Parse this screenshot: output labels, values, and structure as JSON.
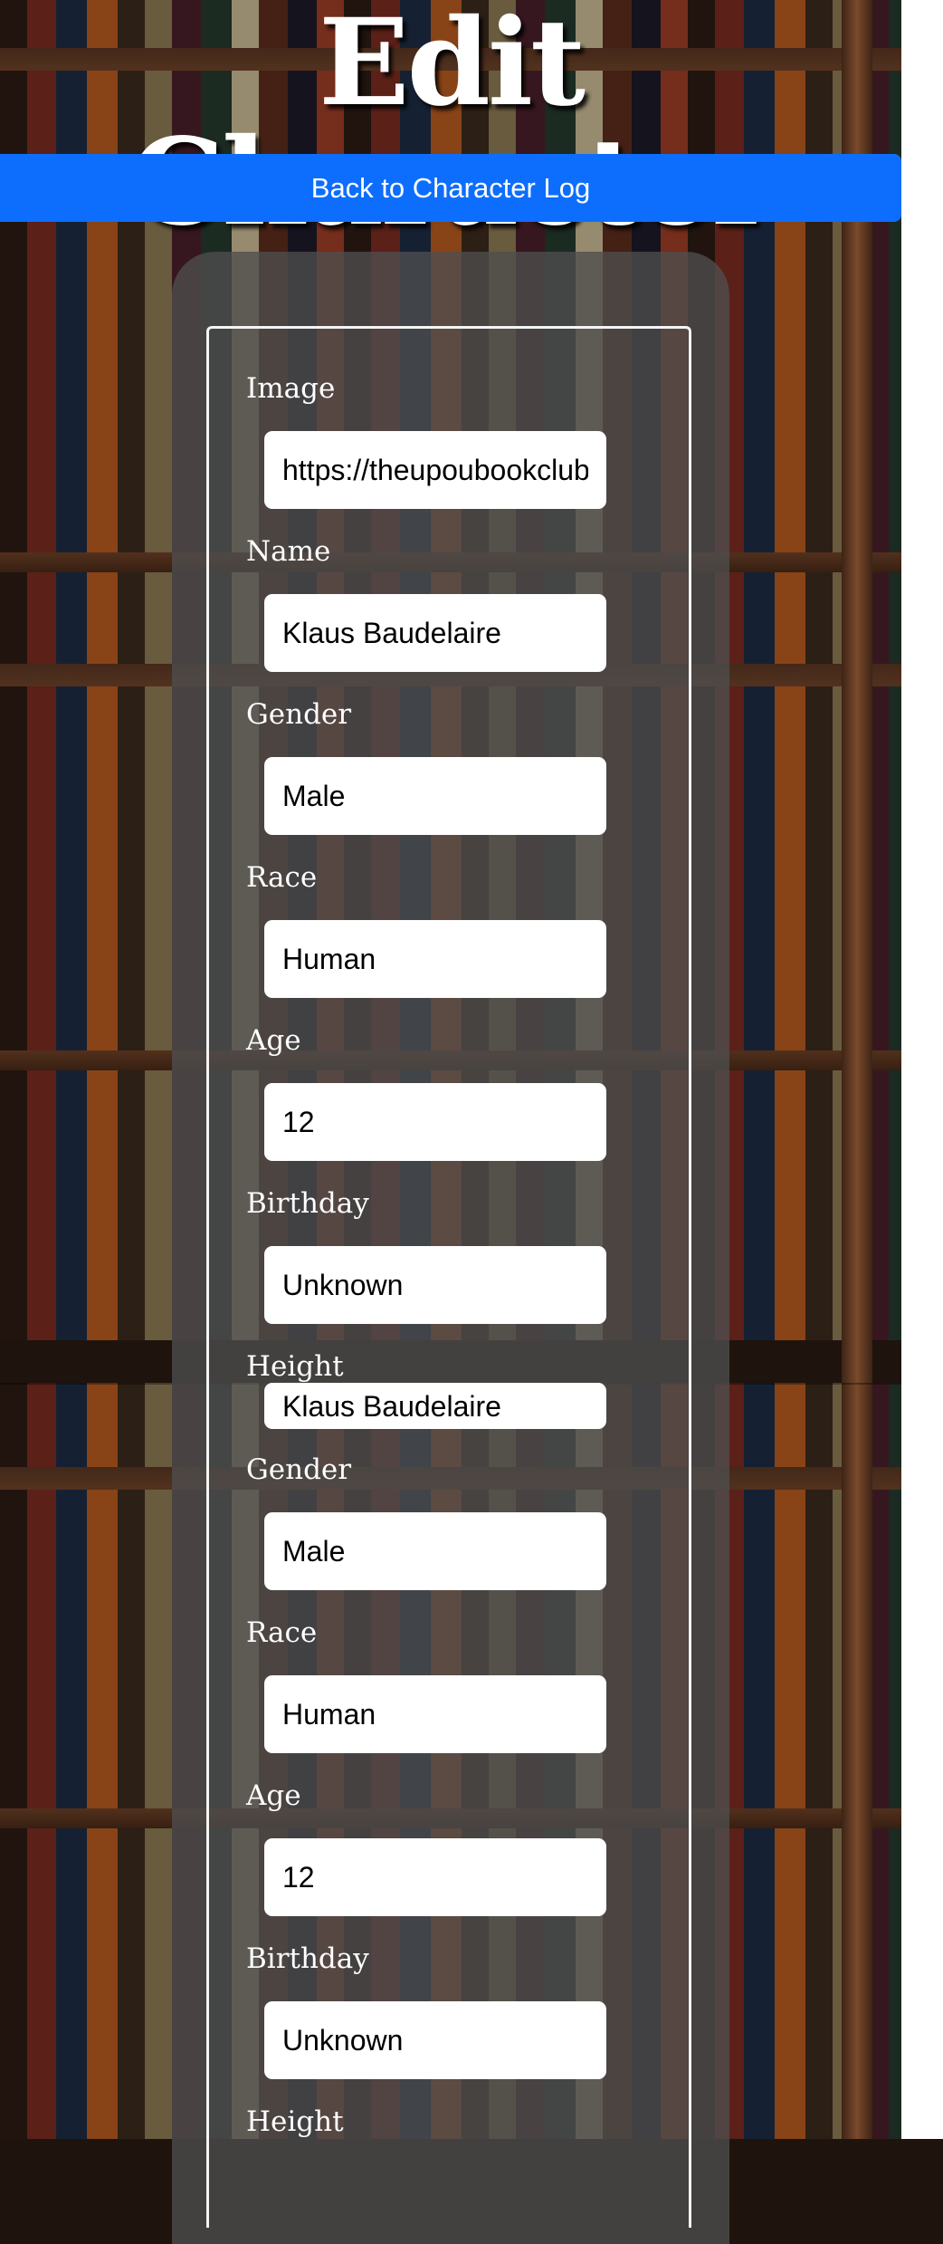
{
  "page": {
    "title": "Edit Character"
  },
  "header": {
    "back_button": "Back to Character Log"
  },
  "form": {
    "fields": [
      {
        "label": "Image",
        "value": "https://theupoubookclub"
      },
      {
        "label": "Name",
        "value": "Klaus Baudelaire"
      },
      {
        "label": "Gender",
        "value": "Male"
      },
      {
        "label": "Race",
        "value": "Human"
      },
      {
        "label": "Age",
        "value": "12"
      },
      {
        "label": "Birthday",
        "value": "Unknown"
      },
      {
        "label": "Height"
      }
    ],
    "repeat": {
      "name_value": "Klaus Baudelaire",
      "fields": [
        {
          "label": "Gender",
          "value": "Male"
        },
        {
          "label": "Race",
          "value": "Human"
        },
        {
          "label": "Age",
          "value": "12"
        },
        {
          "label": "Birthday",
          "value": "Unknown"
        },
        {
          "label": "Height"
        }
      ]
    }
  },
  "colors": {
    "accent": "#0d6efd",
    "panel": "#4e4e4e",
    "text": "#ffffff"
  }
}
